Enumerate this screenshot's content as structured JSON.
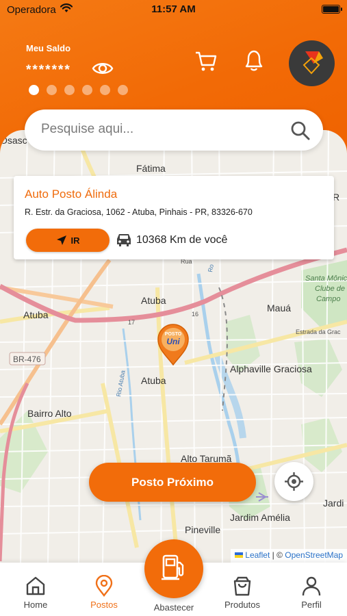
{
  "status_bar": {
    "carrier": "Operadora",
    "time": "11:57 AM"
  },
  "header": {
    "balance_label": "Meu Saldo",
    "balance_value": "*******",
    "carousel_dots": 6,
    "carousel_active": 0
  },
  "search": {
    "placeholder": "Pesquise aqui..."
  },
  "station_card": {
    "name": "Auto Posto Álinda",
    "address": "R. Estr. da Graciosa, 1062 - Atuba, Pinhais - PR, 83326-670",
    "go_label": "IR",
    "distance": "10368 Km de você"
  },
  "map": {
    "labels": {
      "osasco": "Osasc",
      "fatima": "Fátima",
      "atuba1": "Atuba",
      "atuba2": "Atuba",
      "atuba3": "Atuba",
      "maua": "Mauá",
      "santa_monica_1": "Santa Mônic",
      "santa_monica_2": "Clube de",
      "santa_monica_3": "Campo",
      "br476": "BR-476",
      "alphaville": "Alphaville Graciosa",
      "bairro_alto": "Bairro Alto",
      "alto_taruma": "Alto Tarumã",
      "jardim_amelia": "Jardim Amélia",
      "pineville": "Pineville",
      "jardim_right": "Jardi",
      "road_17": "17",
      "road_16": "16",
      "estrada": "Estrada da Grac",
      "rio_atuba": "Rio Atuba",
      "ro": "Ro",
      "ro_right": "R",
      "rua": "Rua",
      "pin_top": "POSTO",
      "pin_brand": "Uni"
    },
    "attribution": {
      "leaflet": "Leaflet",
      "separator": " | © ",
      "osm": "OpenStreetMap"
    }
  },
  "actions": {
    "nearest_label": "Posto Próximo"
  },
  "bottom_nav": {
    "home": "Home",
    "postos": "Postos",
    "abastecer": "Abastecer",
    "produtos": "Produtos",
    "perfil": "Perfil",
    "active": "postos"
  },
  "colors": {
    "brand": "#F26C0A",
    "active_tab": "#F07018"
  }
}
